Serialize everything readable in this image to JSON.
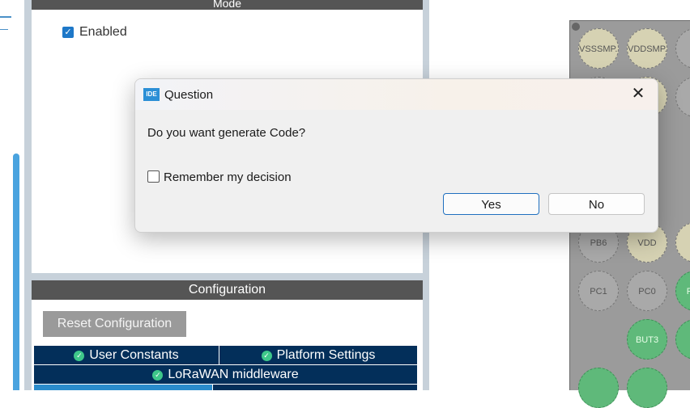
{
  "mode": {
    "header": "Mode",
    "enabled_label": "Enabled",
    "enabled_checked": true
  },
  "configuration": {
    "header": "Configuration",
    "reset_button": "Reset Configuration",
    "tabs": [
      {
        "label": "User Constants"
      },
      {
        "label": "Platform Settings"
      },
      {
        "label": "LoRaWAN middleware"
      }
    ]
  },
  "chip": {
    "pins": [
      "VSSSMP...",
      "VDDSMP...",
      "PB6",
      "VDD",
      "PC1",
      "PC0",
      "BUT3",
      "RF..."
    ]
  },
  "dialog": {
    "title": "Question",
    "icon": "IDE",
    "message": "Do you want generate Code?",
    "remember_label": "Remember my decision",
    "yes_label": "Yes",
    "no_label": "No"
  },
  "colors": {
    "accent": "#1e78c8",
    "tab_bg": "#032f5a",
    "header_bg": "#555555",
    "pin_green": "#5fb97a"
  }
}
